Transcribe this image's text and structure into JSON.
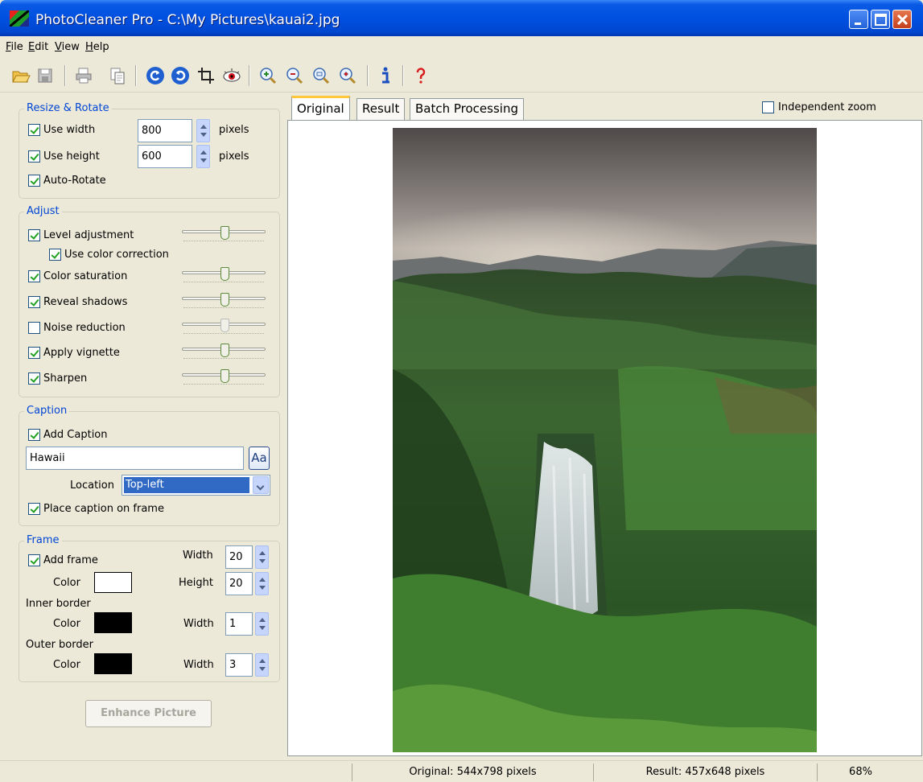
{
  "window": {
    "title": "PhotoCleaner Pro - C:\\My Pictures\\kauai2.jpg"
  },
  "menu": {
    "items": [
      "File",
      "Edit",
      "View",
      "Help"
    ]
  },
  "toolbar": {
    "icons": [
      "open-folder-icon",
      "save-icon",
      "print-icon",
      "copy-icon",
      "rotate-left-icon",
      "rotate-right-icon",
      "crop-icon",
      "red-eye-icon",
      "zoom-in-icon",
      "zoom-out-icon",
      "zoom-fit-icon",
      "zoom-actual-icon",
      "info-icon",
      "help-icon"
    ]
  },
  "resize": {
    "title": "Resize & Rotate",
    "use_width": {
      "label": "Use width",
      "checked": true,
      "value": "800",
      "unit": "pixels"
    },
    "use_height": {
      "label": "Use height",
      "checked": true,
      "value": "600",
      "unit": "pixels"
    },
    "auto_rotate": {
      "label": "Auto-Rotate",
      "checked": true
    }
  },
  "adjust": {
    "title": "Adjust",
    "level": {
      "label": "Level adjustment",
      "checked": true
    },
    "color_correction": {
      "label": "Use color correction",
      "checked": true
    },
    "saturation": {
      "label": "Color saturation",
      "checked": true
    },
    "shadows": {
      "label": "Reveal shadows",
      "checked": true
    },
    "noise": {
      "label": "Noise reduction",
      "checked": false
    },
    "vignette": {
      "label": "Apply vignette",
      "checked": true
    },
    "sharpen": {
      "label": "Sharpen",
      "checked": true
    }
  },
  "caption": {
    "title": "Caption",
    "add": {
      "label": "Add Caption",
      "checked": true
    },
    "text": "Hawaii",
    "font_button": "Aa",
    "location_label": "Location",
    "location_value": "Top-left",
    "on_frame": {
      "label": "Place caption on frame",
      "checked": true
    }
  },
  "frame": {
    "title": "Frame",
    "add": {
      "label": "Add frame",
      "checked": true
    },
    "color_label": "Color",
    "width_label": "Width",
    "height_label": "Height",
    "frame_width": "20",
    "frame_height": "20",
    "frame_color": "#ffffff",
    "inner_label": "Inner border",
    "inner_color": "#000000",
    "inner_width": "1",
    "outer_label": "Outer border",
    "outer_color": "#000000",
    "outer_width": "3"
  },
  "enhance_button": "Enhance Picture",
  "tabs": [
    "Original",
    "Result",
    "Batch Processing"
  ],
  "independent_zoom": {
    "label": "Independent zoom",
    "checked": false
  },
  "status": {
    "original": "Original: 544x798 pixels",
    "result": "Result: 457x648 pixels",
    "zoom": "68%"
  }
}
